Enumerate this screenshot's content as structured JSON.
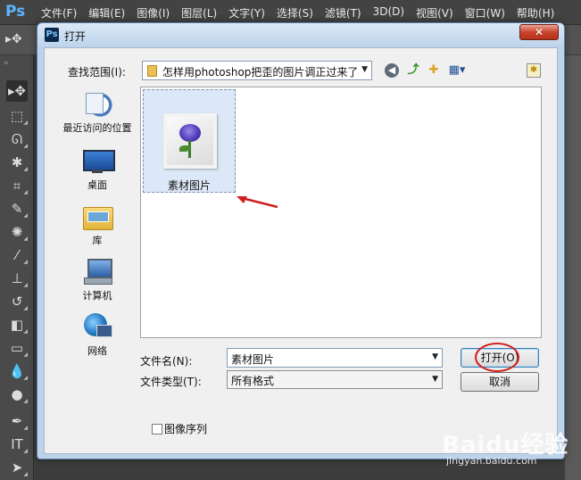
{
  "app": {
    "logo": "Ps"
  },
  "menu": [
    "文件(F)",
    "编辑(E)",
    "图像(I)",
    "图层(L)",
    "文字(Y)",
    "选择(S)",
    "滤镜(T)",
    "3D(D)",
    "视图(V)",
    "窗口(W)",
    "帮助(H)"
  ],
  "dialog": {
    "title": "打开",
    "close_label": "✕",
    "lookin_label": "查找范围(I):",
    "lookin_value": "怎样用photoshop把歪的图片调正过来了",
    "places": [
      "最近访问的位置",
      "桌面",
      "库",
      "计算机",
      "网络"
    ],
    "file": {
      "name": "素材图片"
    },
    "filename_label": "文件名(N):",
    "filename_value": "素材图片",
    "filetype_label": "文件类型(T):",
    "filetype_value": "所有格式",
    "open_button": "打开(O)",
    "cancel_button": "取消",
    "sequence_label": "图像序列"
  },
  "watermark": {
    "text": "Baidu经验",
    "sub": "jingyan.baidu.com"
  },
  "colors": {
    "annotation": "#d01f1f",
    "title_bar": "#bed4ec"
  },
  "icons": [
    "back-icon",
    "up-folder-icon",
    "new-folder-icon",
    "views-menu-icon",
    "desktop-icon"
  ]
}
